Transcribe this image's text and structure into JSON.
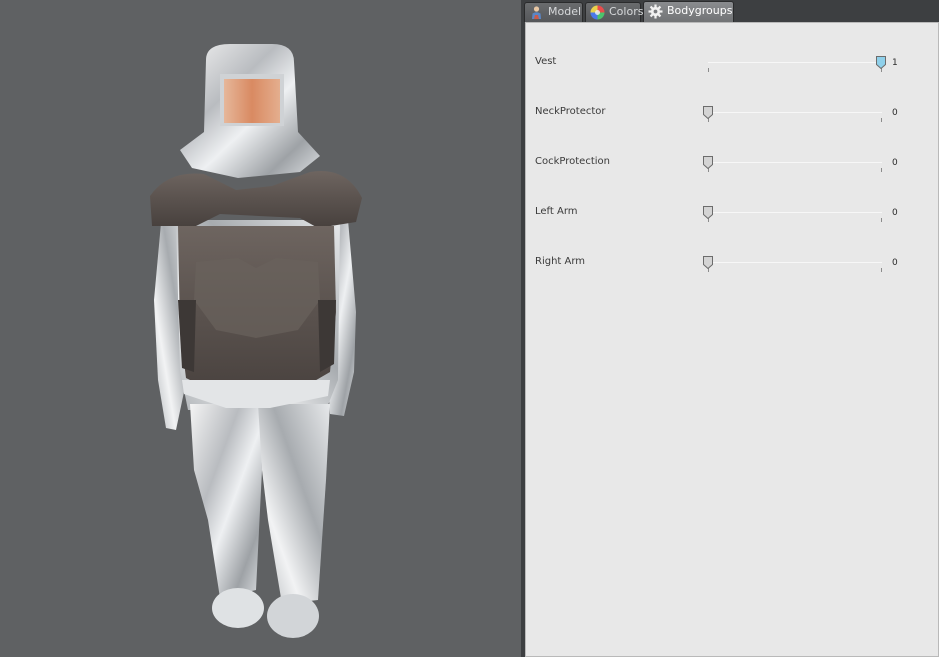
{
  "tabs": [
    {
      "label": "Model",
      "icon": "model-figure-icon",
      "active": false
    },
    {
      "label": "Colors",
      "icon": "color-wheel-icon",
      "active": false
    },
    {
      "label": "Bodygroups",
      "icon": "gear-icon",
      "active": true
    }
  ],
  "bodygroups": [
    {
      "label": "Vest",
      "value": "1",
      "fraction": 1,
      "highlighted": true
    },
    {
      "label": "NeckProtector",
      "value": "0",
      "fraction": 0,
      "highlighted": false
    },
    {
      "label": "CockProtection",
      "value": "0",
      "fraction": 0,
      "highlighted": false
    },
    {
      "label": "Left Arm",
      "value": "0",
      "fraction": 0,
      "highlighted": false
    },
    {
      "label": "Right Arm",
      "value": "0",
      "fraction": 0,
      "highlighted": false
    }
  ],
  "colors": {
    "viewport_bg": "#5f6163",
    "panel_bg": "#e8e8e8",
    "thumb_highlight": "#8fd0ea",
    "thumb_default": "#d4d4d4"
  }
}
